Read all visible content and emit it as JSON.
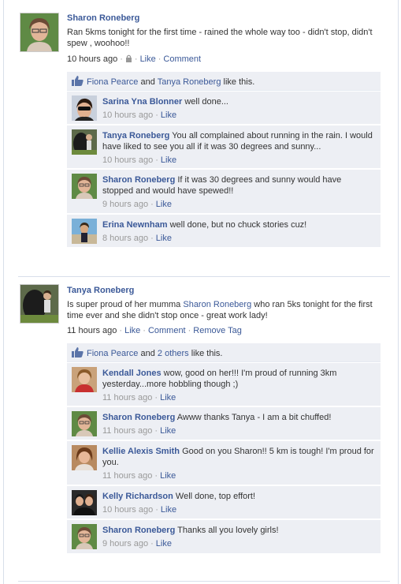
{
  "post1": {
    "author": "Sharon Roneberg",
    "text": "Ran 5kms tonight for the first time - rained the whole way too - didn't stop, didn't spew , woohoo!!",
    "time": "10 hours ago",
    "like": "Like",
    "comment": "Comment",
    "likes": {
      "person1": "Fiona Pearce",
      "and": "and",
      "person2": "Tanya Roneberg",
      "suffix": "like this."
    },
    "comments": [
      {
        "author": "Sarina Yna Blonner",
        "text": "well done...",
        "time": "10 hours ago",
        "like": "Like"
      },
      {
        "author": "Tanya Roneberg",
        "text": "You all complained about running in the rain. I would have liked to see you all if it was 30 degrees and sunny...",
        "time": "10 hours ago",
        "like": "Like"
      },
      {
        "author": "Sharon Roneberg",
        "text": "If it was 30 degrees and sunny would have stopped and would have spewed!!",
        "time": "9 hours ago",
        "like": "Like"
      },
      {
        "author": "Erina Newnham",
        "text": "well done, but no chuck stories cuz!",
        "time": "8 hours ago",
        "like": "Like"
      }
    ]
  },
  "post2": {
    "author": "Tanya Roneberg",
    "text_before": "Is super proud of her mumma",
    "mention": "Sharon Roneberg",
    "text_after": "who ran 5ks tonight for the first time ever and she didn't stop once - great work lady!",
    "time": "11 hours ago",
    "like": "Like",
    "comment": "Comment",
    "remove_tag": "Remove Tag",
    "likes": {
      "person1": "Fiona Pearce",
      "and": "and",
      "others": "2 others",
      "suffix": "like this."
    },
    "comments": [
      {
        "author": "Kendall Jones",
        "text": "wow, good on her!!! I'm proud of running 3km yesterday...more hobbling though ;)",
        "time": "11 hours ago",
        "like": "Like"
      },
      {
        "author": "Sharon Roneberg",
        "text": "Awww thanks Tanya - I am a bit chuffed!",
        "time": "11 hours ago",
        "like": "Like"
      },
      {
        "author": "Kellie Alexis Smith",
        "text": "Good on you Sharon!! 5 km is tough! I'm proud for you.",
        "time": "11 hours ago",
        "like": "Like"
      },
      {
        "author": "Kelly Richardson",
        "text": "Well done, top effort!",
        "time": "10 hours ago",
        "like": "Like"
      },
      {
        "author": "Sharon Roneberg",
        "text": "Thanks all you lovely girls!",
        "time": "9 hours ago",
        "like": "Like"
      }
    ]
  },
  "colors": {
    "link": "#3b5998",
    "comment_bg": "#edeff4",
    "meta": "#999999"
  },
  "icons": {
    "like": "thumbs-up-icon",
    "privacy": "lock-icon"
  }
}
